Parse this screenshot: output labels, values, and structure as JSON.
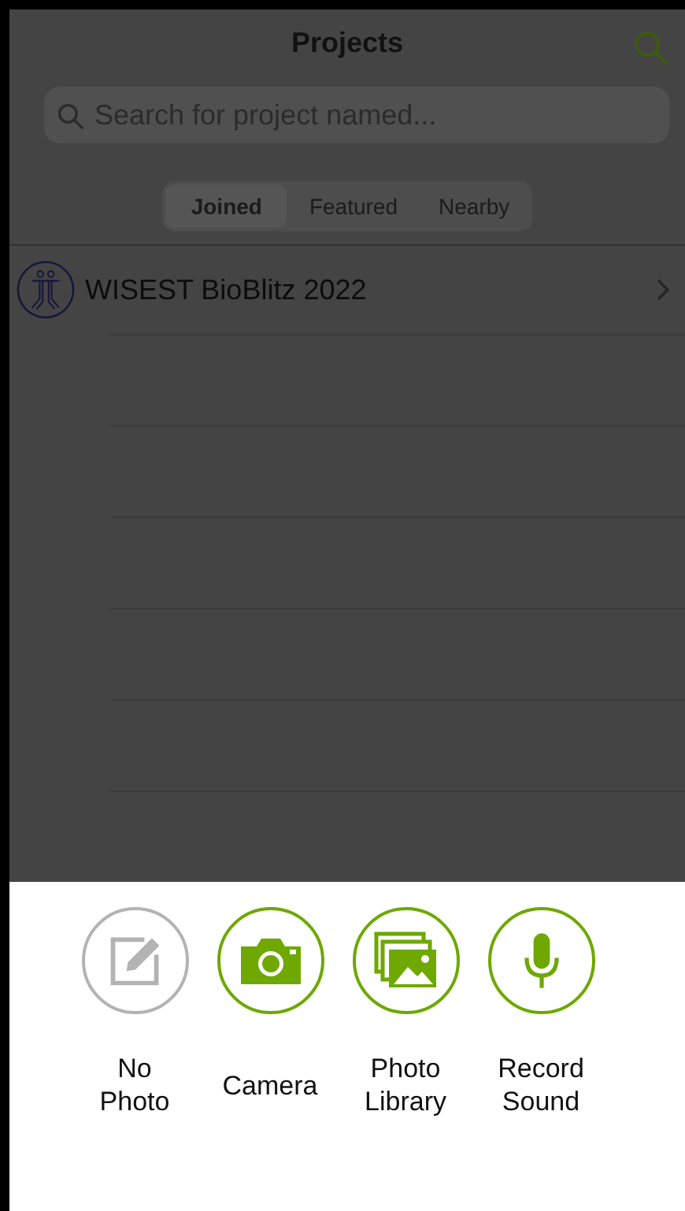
{
  "header": {
    "title": "Projects"
  },
  "search": {
    "placeholder": "Search for project named..."
  },
  "tabs": [
    {
      "label": "Joined",
      "selected": true
    },
    {
      "label": "Featured",
      "selected": false
    },
    {
      "label": "Nearby",
      "selected": false
    }
  ],
  "projects": [
    {
      "name": "WISEST BioBlitz 2022"
    }
  ],
  "options": [
    {
      "kind": "edit",
      "label": "No Photo",
      "disabled": true
    },
    {
      "kind": "camera",
      "label": "Camera",
      "disabled": false
    },
    {
      "kind": "gallery",
      "label": "Photo Library",
      "disabled": false
    },
    {
      "kind": "mic",
      "label": "Record Sound",
      "disabled": false
    }
  ]
}
